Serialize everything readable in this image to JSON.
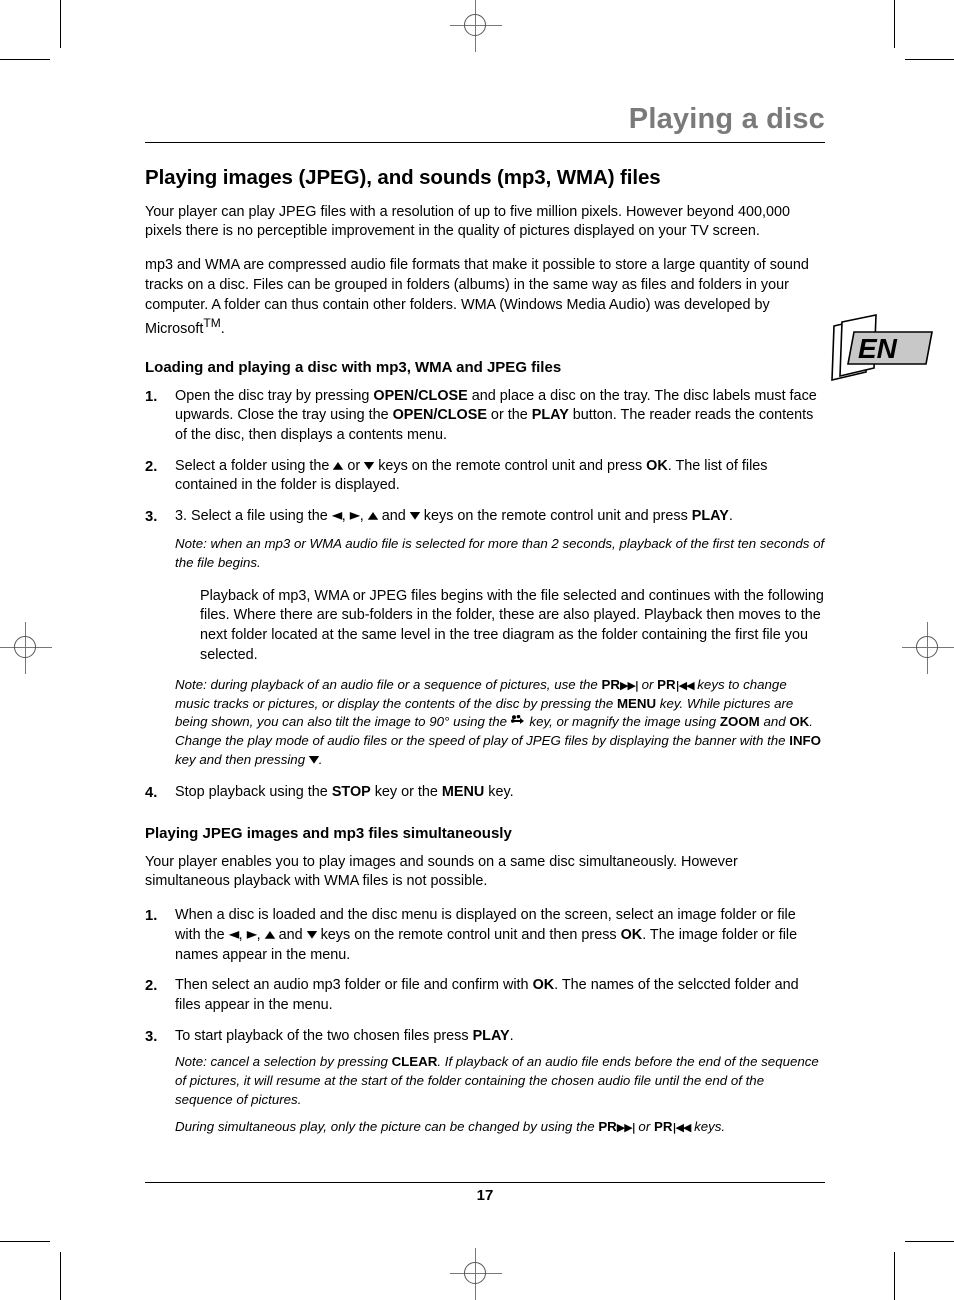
{
  "running_head": "Playing a disc",
  "language_badge": "EN",
  "page_number": "17",
  "title": "Playing images (JPEG), and sounds (mp3, WMA) files",
  "intro": {
    "para1": "Your player can play JPEG files with a resolution of up to five million pixels. However beyond 400,000 pixels there is no perceptible improvement in the quality of pictures displayed on your TV screen.",
    "para2_a": "mp3 and WMA are compressed audio file formats that make it possible to store a large quantity of sound tracks on a disc. Files can be grouped in folders (albums) in the same way as files and folders in your computer. A folder can thus contain other folders. WMA (Windows Media Audio) was developed by Microsoft",
    "para2_tm": "TM",
    "para2_b": "."
  },
  "section1": {
    "heading": "Loading and playing a disc with mp3, WMA and JPEG files",
    "steps": [
      {
        "num": "1.",
        "t1": "Open the disc tray by pressing ",
        "k1": "OPEN/CLOSE",
        "t2": " and place a disc on the tray. The disc labels must face upwards. Close the tray using the ",
        "k2": "OPEN/CLOSE",
        "t3": " or the ",
        "k3": "PLAY",
        "t4": " button. The reader reads the contents of the disc, then displays a contents menu."
      },
      {
        "num": "2.",
        "t1": "Select a folder using the ",
        "a1": "▲",
        "t2": " or ",
        "a2": "▼",
        "t3": " keys on the remote control unit and press ",
        "k1": "OK",
        "t4": ". The list of files contained in the folder is displayed."
      },
      {
        "num": "3.",
        "t1": "3. Select a file using the ",
        "a1": "◀",
        "t2": ", ",
        "a2": "▶",
        "t3": ", ",
        "a3": "▲",
        "t4": " and ",
        "a4": "▼",
        "t5": " keys on the remote control unit and press ",
        "k1": "PLAY",
        "t6": ".",
        "note": "Note: when an mp3 or WMA audio file is selected for more than 2 seconds, playback of the first ten seconds of the file begins.",
        "para": "Playback of mp3, WMA or JPEG files begins with the file selected and continues with the following files. Where there are sub-folders in the folder, these are also played. Playback then moves to the next folder located at the same level in the tree diagram as the folder containing the first file you selected.",
        "note2": {
          "t1": "Note: during playback of an audio file or a sequence of pictures, use the ",
          "k1": "PR",
          "i1": "▶▶|",
          "t2": " or ",
          "k2": "PR",
          "i2": "|◀◀",
          "t3": " keys to change music tracks or pictures, or display the contents of the disc by pressing the ",
          "k3": "MENU",
          "t4": " key. While pictures are being shown, you can also tilt the image to 90° using the ",
          "icon": "rotate-icon",
          "t5": " key, or magnify the image using ",
          "k4": "ZOOM",
          "t6": " and ",
          "k5": "OK",
          "t7": ". Change the play mode of audio files or the speed of play of JPEG files by displaying the banner with the ",
          "k6": "INFO",
          "t8": " key and then pressing ",
          "a1": "▼",
          "t9": "."
        }
      },
      {
        "num": "4.",
        "t1": "Stop playback using the ",
        "k1": "STOP",
        "t2": " key or the ",
        "k2": "MENU",
        "t3": " key."
      }
    ]
  },
  "section2": {
    "heading": "Playing JPEG images and mp3 files simultaneously",
    "intro": "Your player enables you to play images and sounds on a same disc simultaneously. However simultaneous playback with WMA files is not possible.",
    "steps": [
      {
        "num": "1.",
        "t1": "When a disc is loaded and the disc menu is displayed on the screen, select an image folder or file with the ",
        "a1": "◀",
        "t2": ", ",
        "a2": "▶",
        "t3": ", ",
        "a3": "▲",
        "t4": " and ",
        "a4": "▼",
        "t5": " keys on the remote control unit and then press ",
        "k1": "OK",
        "t6": ". The image folder or file names appear in the menu."
      },
      {
        "num": "2.",
        "t1": "Then select an audio mp3 folder or file and confirm with ",
        "k1": "OK",
        "t2": ". The names of the selccted folder and files appear in the menu."
      },
      {
        "num": "3.",
        "t1": "To start playback of the two chosen files press ",
        "k1": "PLAY",
        "t2": ".",
        "note1": {
          "t1": "Note: cancel a selection by pressing ",
          "k1": "CLEAR",
          "t2": ". If playback of an audio file ends before the end of the sequence of pictures, it will resume at the start of the folder containing the chosen audio file until the end of the sequence of pictures."
        },
        "note2": {
          "t1": "During simultaneous play, only the picture can be changed by using the ",
          "k1": "PR",
          "i1": "▶▶|",
          "t2": " or ",
          "k2": "PR",
          "i2": "|◀◀",
          "t3": " keys."
        }
      }
    ]
  },
  "colors": {
    "running_head": "#7a7a7a",
    "badge_fill": "#c8c8c8",
    "text": "#000000"
  }
}
